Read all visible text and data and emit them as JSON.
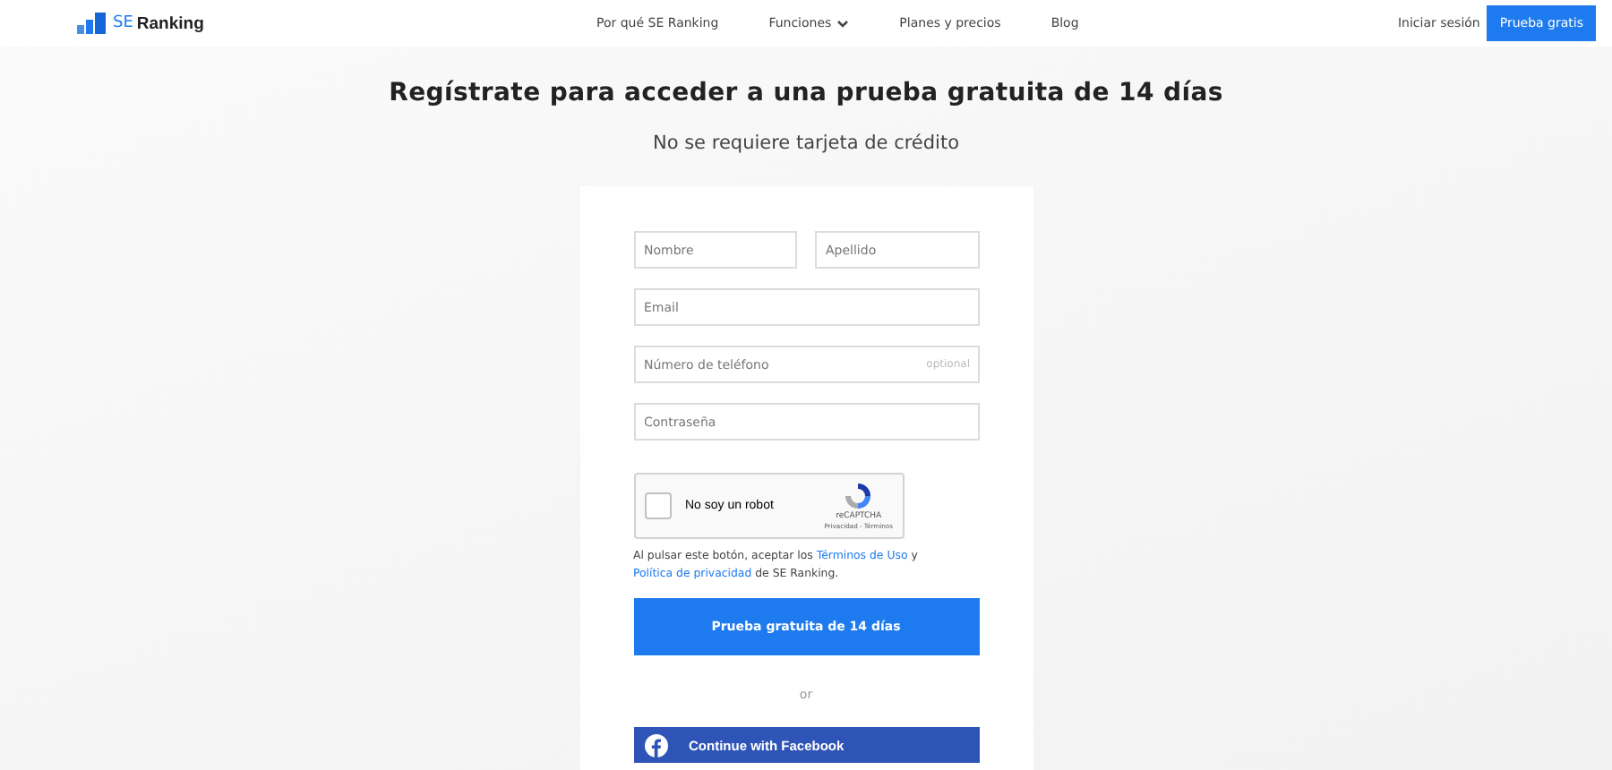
{
  "header": {
    "logo": {
      "prefix": "SE",
      "name": "Ranking"
    },
    "nav": [
      {
        "label": "Por qué SE Ranking",
        "dropdown": false
      },
      {
        "label": "Funciones",
        "dropdown": true
      },
      {
        "label": "Planes y precios",
        "dropdown": false
      },
      {
        "label": "Blog",
        "dropdown": false
      }
    ],
    "login": "Iniciar sesión",
    "cta": "Prueba gratis"
  },
  "title": "Regístrate para acceder a una prueba gratuita de 14 días",
  "subtitle": "No se requiere tarjeta de crédito",
  "form": {
    "fields": [
      [
        {
          "placeholder": "Nombre"
        },
        {
          "placeholder": "Apellido"
        }
      ],
      [
        {
          "placeholder": "Email"
        }
      ],
      [
        {
          "placeholder": "Número de teléfono",
          "hint": "optional"
        }
      ],
      [
        {
          "placeholder": "Contraseña"
        }
      ]
    ],
    "captcha": {
      "label": "No soy un robot",
      "checked": false,
      "brand": "reCAPTCHA",
      "links": "Privacidad - Términos"
    },
    "terms": {
      "before": "Al pulsar este botón, aceptar los ",
      "link1": "Términos de Uso",
      "middle": " y ",
      "link2": "Política de privacidad",
      "after": " de SE Ranking."
    },
    "submit": "Prueba gratuita de 14 días",
    "divider": "or",
    "facebook": "Continue with Facebook"
  }
}
